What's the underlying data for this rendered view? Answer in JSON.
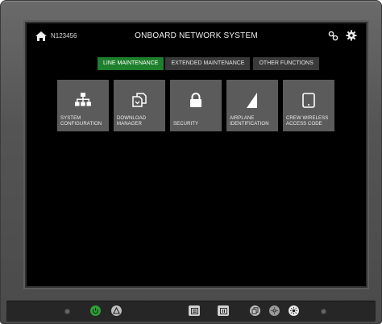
{
  "header": {
    "tail_number": "N123456",
    "title": "ONBOARD NETWORK SYSTEM",
    "icons": [
      "home-icon",
      "link-icon",
      "gear-icon"
    ]
  },
  "tabs": [
    {
      "label": "LINE MAINTENANCE",
      "active": true
    },
    {
      "label": "EXTENDED MAINTENANCE",
      "active": false
    },
    {
      "label": "OTHER FUNCTIONS",
      "active": false
    }
  ],
  "tiles": [
    {
      "label": "SYSTEM\nCONFIGURATION",
      "icon": "network-hierarchy-icon"
    },
    {
      "label": "DOWNLOAD\nMANAGER",
      "icon": "download-manager-icon"
    },
    {
      "label": "SECURITY",
      "icon": "lock-icon"
    },
    {
      "label": "AIRPLANE\nIDENTIFICATION",
      "icon": "wedge-icon"
    },
    {
      "label": "CREW WIRELESS\nACCESS CODE",
      "icon": "tablet-icon"
    }
  ],
  "colors": {
    "active_tab": "#1e7f2c",
    "tile_bg": "#5b5b5b",
    "screen_bg": "#000000",
    "power_green": "#2f9f3a"
  },
  "bezel_controls": [
    "indicator-dot",
    "power-button",
    "alert-button",
    "menu-button",
    "pause-button",
    "display-button",
    "brightness-down-button",
    "brightness-up-button",
    "indicator-dot"
  ]
}
